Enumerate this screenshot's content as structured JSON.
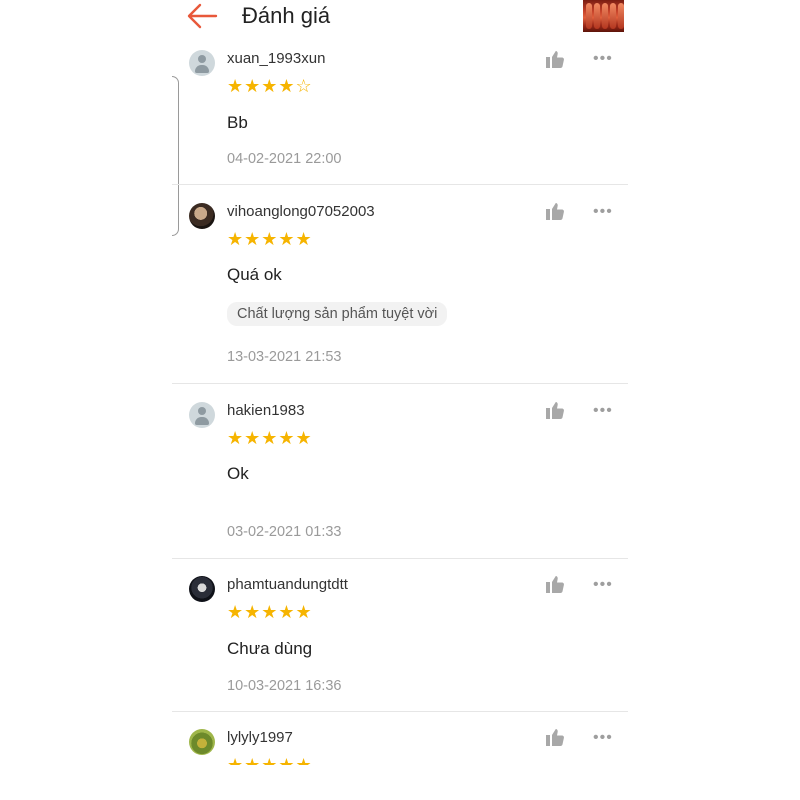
{
  "header": {
    "title": "Đánh giá",
    "back_icon": "arrow-left-icon",
    "accent_color": "#e8583a"
  },
  "star_color": "#f6b400",
  "reviews": [
    {
      "username": "xuan_1993xun",
      "rating": 4,
      "stars": "★★★★",
      "empty_stars": "☆",
      "comment": "Bb",
      "tag": "",
      "date": "04-02-2021 22:00",
      "avatar": "default"
    },
    {
      "username": "vihoanglong07052003",
      "rating": 5,
      "stars": "★★★★★",
      "empty_stars": "",
      "comment": "Quá ok",
      "tag": "Chất lượng sản phẩm tuyệt vời",
      "date": "13-03-2021 21:53",
      "avatar": "photo"
    },
    {
      "username": "hakien1983",
      "rating": 5,
      "stars": "★★★★★",
      "empty_stars": "",
      "comment": "Ok",
      "tag": "",
      "date": "03-02-2021 01:33",
      "avatar": "default"
    },
    {
      "username": "phamtuandungtdtt",
      "rating": 5,
      "stars": "★★★★★",
      "empty_stars": "",
      "comment": "Chưa dùng",
      "tag": "",
      "date": "10-03-2021 16:36",
      "avatar": "photo"
    },
    {
      "username": "lylyly1997",
      "rating": 5,
      "stars": "★★★★★",
      "empty_stars": "",
      "comment": "",
      "tag": "",
      "date": "",
      "avatar": "photo"
    }
  ],
  "more_label": "•••"
}
